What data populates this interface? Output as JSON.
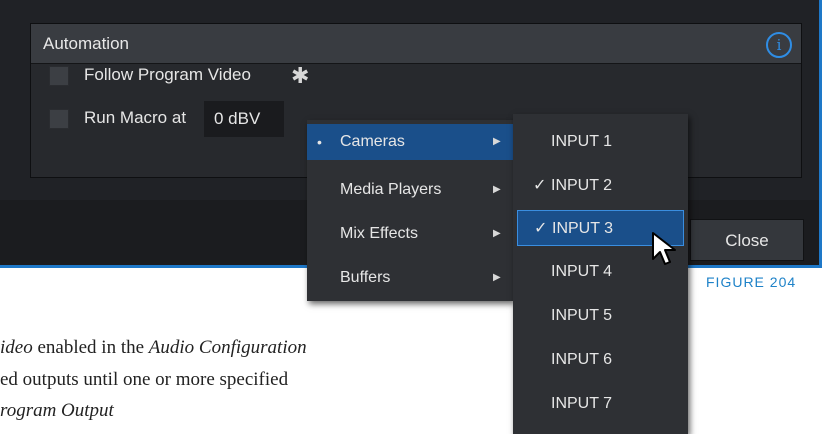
{
  "panel": {
    "title": "Automation",
    "info_icon": "i",
    "follow_label": "Follow Program Video",
    "run_macro_label": "Run Macro at",
    "dbv_value": "0 dBV",
    "gear_icon": "✱"
  },
  "dialog": {
    "close_label": "Close"
  },
  "menu1": {
    "items": [
      {
        "label": "Cameras",
        "arrow": "▶",
        "bullet": "•"
      },
      {
        "label": "Media Players",
        "arrow": "▶"
      },
      {
        "label": "Mix Effects",
        "arrow": "▶"
      },
      {
        "label": "Buffers",
        "arrow": "▶"
      }
    ]
  },
  "menu2": {
    "items": [
      {
        "label": "INPUT 1",
        "check": ""
      },
      {
        "label": "INPUT 2",
        "check": "✓"
      },
      {
        "label": "INPUT 3",
        "check": "✓"
      },
      {
        "label": "INPUT 4",
        "check": ""
      },
      {
        "label": "INPUT 5",
        "check": ""
      },
      {
        "label": "INPUT 6",
        "check": ""
      },
      {
        "label": "INPUT 7",
        "check": ""
      }
    ]
  },
  "figure_label": "FIGURE 204",
  "body": {
    "line1_italic1": "ideo",
    "line1_text": " enabled in the ",
    "line1_italic2": "Audio Configuration",
    "line2_text": "ed outputs until one or more specified",
    "line3_italic": "rogram Output"
  },
  "colors": {
    "accent": "#1e78c8",
    "highlight": "#1a4f8a",
    "figure_label": "#1e82c8"
  }
}
